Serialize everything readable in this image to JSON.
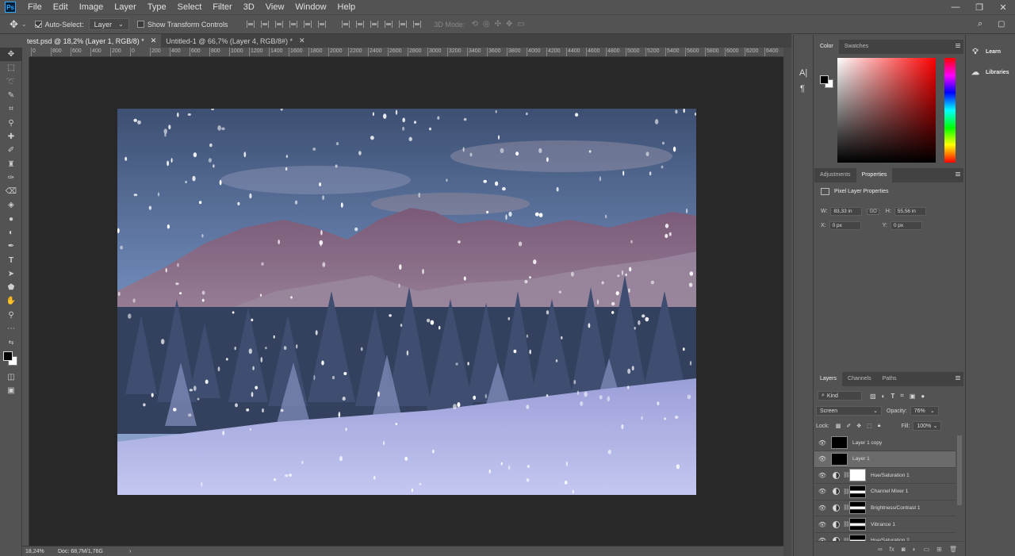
{
  "app": {
    "logo": "Ps"
  },
  "menubar": {
    "items": [
      "File",
      "Edit",
      "Image",
      "Layer",
      "Type",
      "Select",
      "Filter",
      "3D",
      "View",
      "Window",
      "Help"
    ]
  },
  "window_controls": {
    "minimize": "—",
    "restore": "❐",
    "close": "✕"
  },
  "options": {
    "auto_select_label": "Auto-Select:",
    "auto_select_value": "Layer",
    "show_transform_label": "Show Transform Controls",
    "mode_3d_label": "3D Mode:"
  },
  "document_tabs": [
    {
      "label": "test.psd @ 18,2% (Layer 1, RGB/8) *",
      "close": "✕"
    },
    {
      "label": "Untitled-1 @ 66,7% (Layer 4, RGB/8#) *",
      "close": "✕"
    }
  ],
  "ruler_h": [
    "0",
    "800",
    "600",
    "400",
    "200",
    "0",
    "200",
    "400",
    "600",
    "800",
    "1000",
    "1200",
    "1400",
    "1600",
    "1800",
    "2000",
    "2200",
    "2400",
    "2600",
    "2800",
    "3000",
    "3200",
    "3400",
    "3600",
    "3800",
    "4000",
    "4200",
    "4400",
    "4600",
    "4800",
    "5000",
    "5200",
    "5400",
    "5600",
    "5800",
    "6000",
    "6200",
    "6400",
    "6600",
    "680"
  ],
  "status": {
    "zoom": "18,24%",
    "doc": "Doc: 68,7M/1,76G",
    "arrow": "›"
  },
  "color_panel": {
    "tabs": [
      "Color",
      "Swatches"
    ],
    "fg": "#000000",
    "bg": "#ffffff"
  },
  "properties_panel": {
    "tabs": [
      "Adjustments",
      "Properties"
    ],
    "title": "Pixel Layer Properties",
    "w_label": "W:",
    "w_value": "83,33 in",
    "link": "GO",
    "h_label": "H:",
    "h_value": "55,56 in",
    "x_label": "X:",
    "x_value": "0 px",
    "y_label": "Y:",
    "y_value": "0 px"
  },
  "layers_panel": {
    "tabs": [
      "Layers",
      "Channels",
      "Paths"
    ],
    "kind_label": "Kind",
    "blend_mode": "Screen",
    "opacity_label": "Opacity:",
    "opacity_value": "76%",
    "lock_label": "Lock:",
    "fill_label": "Fill:",
    "fill_value": "100%",
    "layers": [
      {
        "name": "Layer 1 copy",
        "type": "pixel",
        "selected": false
      },
      {
        "name": "Layer 1",
        "type": "pixel",
        "selected": true
      },
      {
        "name": "Hue/Saturation 1",
        "type": "adjustment",
        "selected": false
      },
      {
        "name": "Channel Mixer 1",
        "type": "adjustment",
        "selected": false
      },
      {
        "name": "Brightness/Contrast 1",
        "type": "adjustment",
        "selected": false
      },
      {
        "name": "Vibrance 1",
        "type": "adjustment",
        "selected": false
      },
      {
        "name": "Hue/Saturation 2",
        "type": "adjustment",
        "selected": false
      }
    ]
  },
  "right_panel": {
    "learn": "Learn",
    "libraries": "Libraries"
  }
}
